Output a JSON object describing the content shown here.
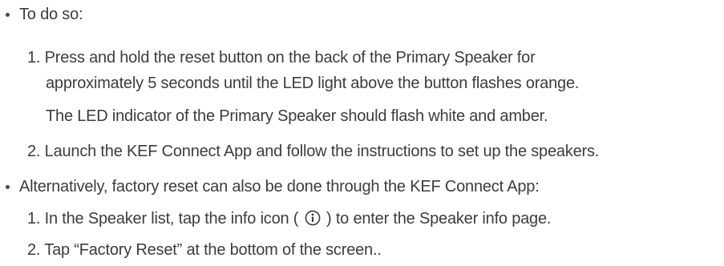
{
  "bullets": [
    {
      "text": "To do so:",
      "steps": [
        {
          "number": "1.",
          "lines": [
            "Press and hold the reset button on the back of the Primary Speaker for",
            "approximately 5 seconds until the LED light above the button flashes orange."
          ]
        },
        {
          "number": "",
          "lines": [
            "The LED indicator of the Primary Speaker should flash white and amber."
          ]
        },
        {
          "number": "2.",
          "lines": [
            "Launch the KEF Connect App and follow the instructions to set up the speakers."
          ]
        }
      ]
    },
    {
      "text": "Alternatively, factory reset can also be done through the KEF Connect App:",
      "steps": [
        {
          "number": "1.",
          "before_icon": "In the Speaker list, tap the info icon (",
          "icon": "info-icon",
          "after_icon": ") to enter the Speaker info page."
        },
        {
          "number": "2.",
          "lines": [
            "Tap “Factory Reset” at the bottom of the screen.."
          ]
        }
      ]
    }
  ]
}
